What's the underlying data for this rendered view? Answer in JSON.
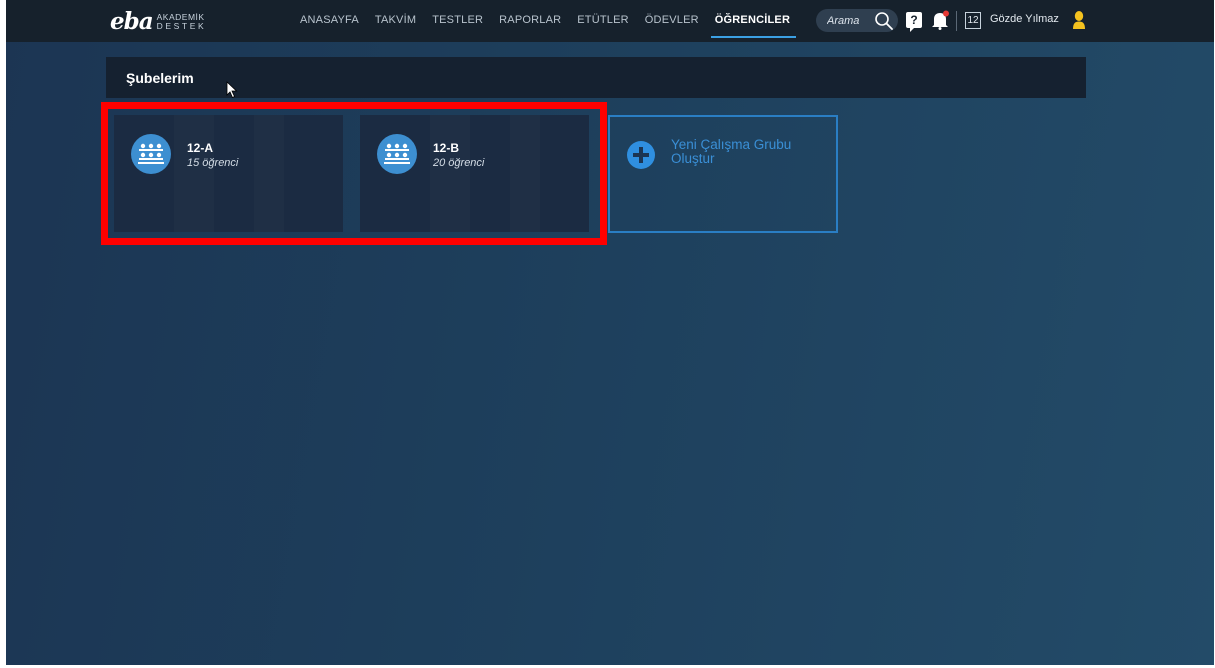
{
  "brand": {
    "logo_main": "eba",
    "logo_sub_line1": "AKADEMİK",
    "logo_sub_line2": "DESTEK"
  },
  "nav": {
    "items": [
      {
        "label": "ANASAYFA",
        "active": false
      },
      {
        "label": "TAKVİM",
        "active": false
      },
      {
        "label": "TESTLER",
        "active": false
      },
      {
        "label": "RAPORLAR",
        "active": false
      },
      {
        "label": "ETÜTLER",
        "active": false
      },
      {
        "label": "ÖDEVLER",
        "active": false
      },
      {
        "label": "ÖĞRENCİLER",
        "active": true
      }
    ]
  },
  "search": {
    "placeholder": "Arama",
    "icon": "search-icon"
  },
  "header_right": {
    "help_label": "?",
    "notification_icon": "bell-icon",
    "class_badge": "12",
    "user_name": "Gözde Yılmaz",
    "user_icon": "user-icon"
  },
  "section": {
    "title": "Şubelerim"
  },
  "groups": [
    {
      "name": "12-A",
      "count": "15 öğrenci",
      "icon": "group-icon"
    },
    {
      "name": "12-B",
      "count": "20 öğrenci",
      "icon": "group-icon"
    }
  ],
  "new_group": {
    "label": "Yeni Çalışma Grubu Oluştur",
    "icon": "plus-icon"
  },
  "colors": {
    "topbar_bg": "#16212c",
    "accent": "#3ba0e4",
    "card_bg": "#1b2b42",
    "highlight": "#ff0000",
    "new_group_border": "#2a7ec4"
  }
}
